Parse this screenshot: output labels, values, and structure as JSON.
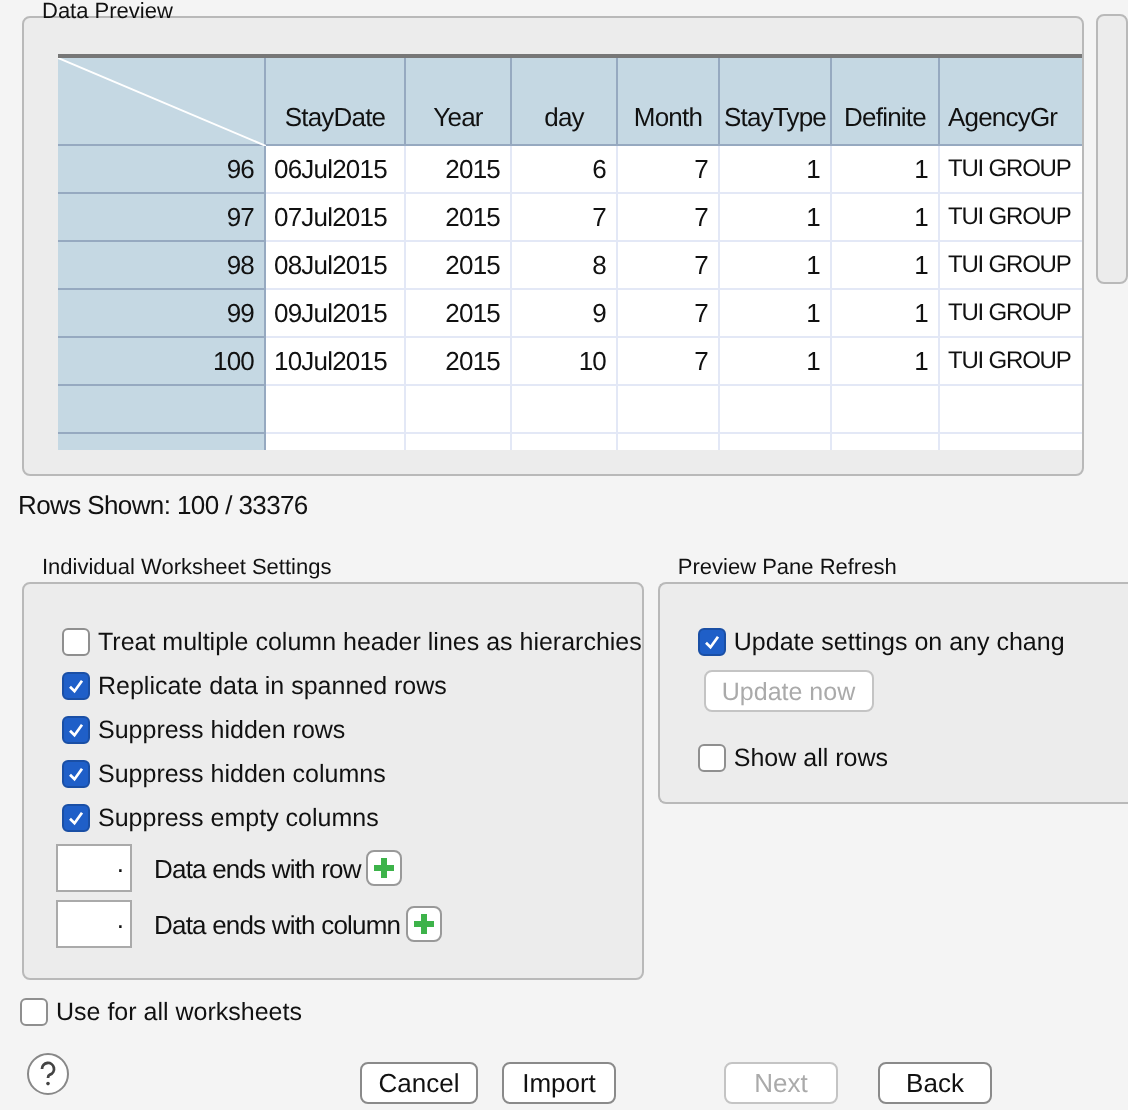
{
  "preview": {
    "title": "Data Preview",
    "columns": [
      "StayDate",
      "Year",
      "day",
      "Month",
      "StayType",
      "Definite",
      "AgencyGr"
    ],
    "rows": [
      {
        "header": "96",
        "cells": [
          "06Jul2015",
          "2015",
          "6",
          "7",
          "1",
          "1",
          "TUI GROUP"
        ]
      },
      {
        "header": "97",
        "cells": [
          "07Jul2015",
          "2015",
          "7",
          "7",
          "1",
          "1",
          "TUI GROUP"
        ]
      },
      {
        "header": "98",
        "cells": [
          "08Jul2015",
          "2015",
          "8",
          "7",
          "1",
          "1",
          "TUI GROUP"
        ]
      },
      {
        "header": "99",
        "cells": [
          "09Jul2015",
          "2015",
          "9",
          "7",
          "1",
          "1",
          "TUI GROUP"
        ]
      },
      {
        "header": "100",
        "cells": [
          "10Jul2015",
          "2015",
          "10",
          "7",
          "1",
          "1",
          "TUI GROUP"
        ]
      }
    ]
  },
  "rows_shown": "Rows Shown: 100 / 33376",
  "worksheet_settings": {
    "title": "Individual Worksheet Settings",
    "options": [
      {
        "label": "Treat multiple column header lines as hierarchies",
        "checked": false
      },
      {
        "label": "Replicate data in spanned rows",
        "checked": true
      },
      {
        "label": "Suppress hidden rows",
        "checked": true
      },
      {
        "label": "Suppress hidden columns",
        "checked": true
      },
      {
        "label": "Suppress empty columns",
        "checked": true
      }
    ],
    "end_fields": [
      {
        "value": ".",
        "label": "Data ends with row"
      },
      {
        "value": ".",
        "label": "Data ends with column"
      }
    ]
  },
  "preview_refresh": {
    "title": "Preview Pane Refresh",
    "update_on_change": {
      "label": "Update settings on any chang",
      "checked": true
    },
    "update_now": {
      "label": "Update now",
      "disabled": true
    },
    "show_all_rows": {
      "label": "Show all rows",
      "checked": false
    }
  },
  "use_for_all": {
    "label": "Use for all worksheets",
    "checked": false
  },
  "buttons": [
    {
      "label": "Cancel",
      "disabled": false
    },
    {
      "label": "Import",
      "disabled": false
    },
    {
      "label": "Next",
      "disabled": true
    },
    {
      "label": "Back",
      "disabled": false
    }
  ]
}
